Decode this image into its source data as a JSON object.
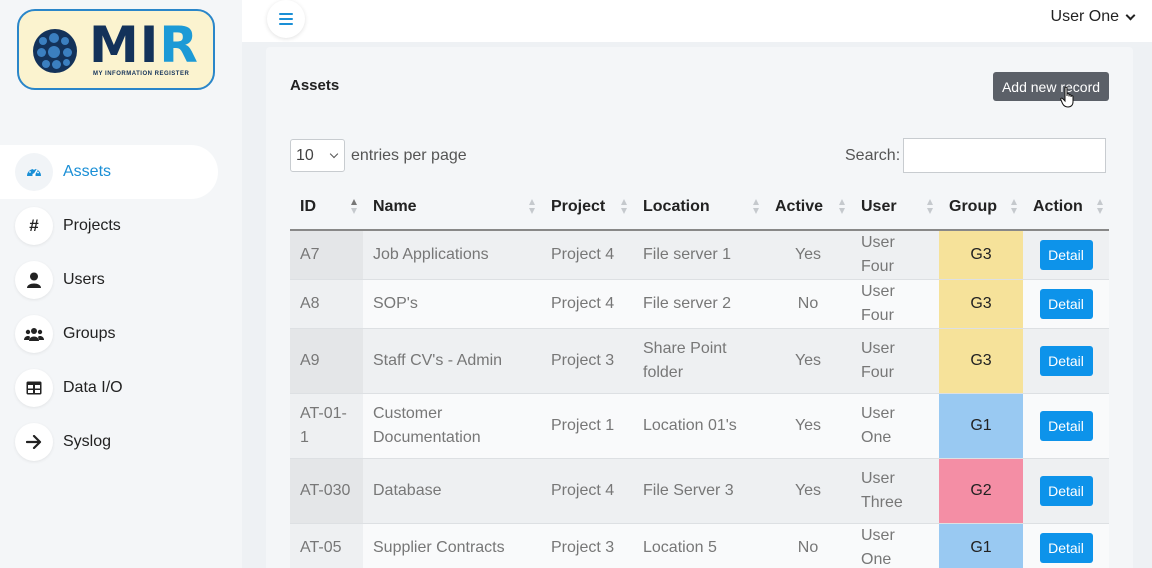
{
  "brand": {
    "name_main": "MI",
    "name_accent": "R",
    "tagline": "MY INFORMATION REGISTER"
  },
  "sidebar": {
    "items": [
      {
        "label": "Assets",
        "icon": "gauge-icon",
        "active": true
      },
      {
        "label": "Projects",
        "icon": "hash-icon"
      },
      {
        "label": "Users",
        "icon": "user-icon"
      },
      {
        "label": "Groups",
        "icon": "users-icon"
      },
      {
        "label": "Data I/O",
        "icon": "table-icon"
      },
      {
        "label": "Syslog",
        "icon": "arrow-right-icon"
      }
    ]
  },
  "header": {
    "menu_icon": "hamburger-icon",
    "user_name": "User One"
  },
  "page": {
    "title": "Assets",
    "add_button": "Add new record",
    "per_page_value": "10",
    "per_page_label": "entries per page",
    "search_label": "Search:",
    "search_value": ""
  },
  "table": {
    "columns": [
      "ID",
      "Name",
      "Project",
      "Location",
      "Active",
      "User",
      "Group",
      "Action"
    ],
    "rows": [
      {
        "id": "A7",
        "name": "Job Applications",
        "project": "Project 4",
        "location": "File server 1",
        "active": "Yes",
        "user": "User Four",
        "group": "G3",
        "action": "Detail"
      },
      {
        "id": "A8",
        "name": "SOP's",
        "project": "Project 4",
        "location": "File server 2",
        "active": "No",
        "user": "User Four",
        "group": "G3",
        "action": "Detail"
      },
      {
        "id": "A9",
        "name": "Staff CV's - Admin",
        "project": "Project 3",
        "location": "Share Point folder",
        "active": "Yes",
        "user": "User Four",
        "group": "G3",
        "action": "Detail"
      },
      {
        "id": "AT-01-1",
        "name": "Customer Documentation",
        "project": "Project 1",
        "location": "Location 01's",
        "active": "Yes",
        "user": "User One",
        "group": "G1",
        "action": "Detail"
      },
      {
        "id": "AT-030",
        "name": "Database",
        "project": "Project 4",
        "location": "File Server 3",
        "active": "Yes",
        "user": "User Three",
        "group": "G2",
        "action": "Detail"
      },
      {
        "id": "AT-05",
        "name": "Supplier Contracts",
        "project": "Project 3",
        "location": "Location 5",
        "active": "No",
        "user": "User One",
        "group": "G1",
        "action": "Detail"
      }
    ]
  },
  "colors": {
    "accent": "#1a8fd6",
    "detail_button": "#0d93ea",
    "g1": "#99c9f2",
    "g2": "#f48ea5",
    "g3": "#f6e29a"
  }
}
